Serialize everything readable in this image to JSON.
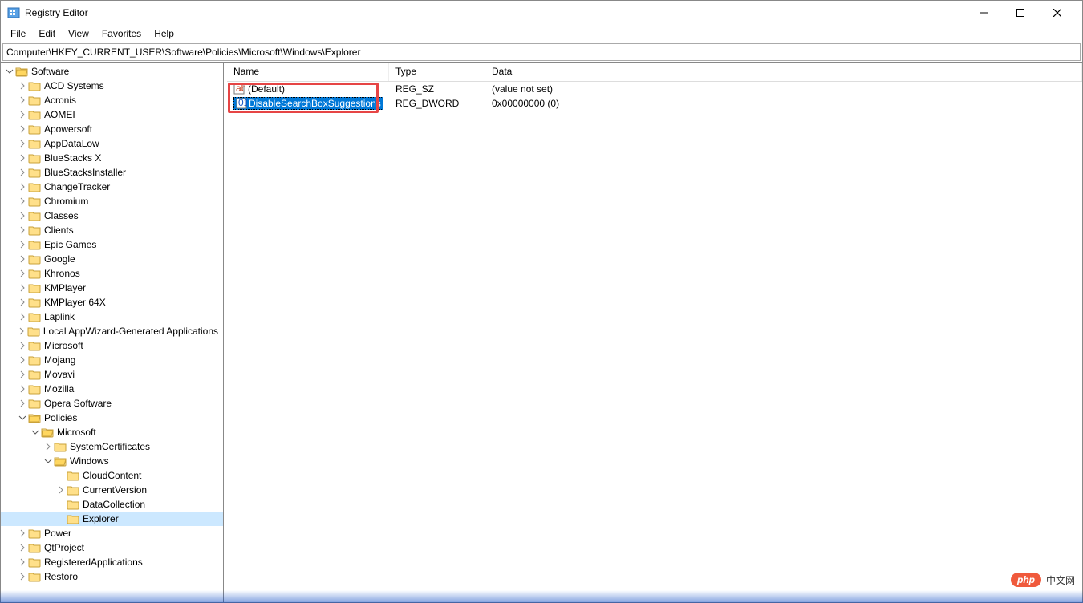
{
  "window": {
    "title": "Registry Editor"
  },
  "menubar": [
    "File",
    "Edit",
    "View",
    "Favorites",
    "Help"
  ],
  "address": "Computer\\HKEY_CURRENT_USER\\Software\\Policies\\Microsoft\\Windows\\Explorer",
  "columns": {
    "name": "Name",
    "type": "Type",
    "data": "Data"
  },
  "values": [
    {
      "icon": "sz",
      "name": "(Default)",
      "type": "REG_SZ",
      "data": "(value not set)",
      "editing": false
    },
    {
      "icon": "dw",
      "name": "DisableSearchBoxSuggestions",
      "type": "REG_DWORD",
      "data": "0x00000000 (0)",
      "editing": true
    }
  ],
  "tree": [
    {
      "depth": 0,
      "toggle": "open",
      "label": "Software",
      "open": true
    },
    {
      "depth": 1,
      "toggle": "closed",
      "label": "ACD Systems"
    },
    {
      "depth": 1,
      "toggle": "closed",
      "label": "Acronis"
    },
    {
      "depth": 1,
      "toggle": "closed",
      "label": "AOMEI"
    },
    {
      "depth": 1,
      "toggle": "closed",
      "label": "Apowersoft"
    },
    {
      "depth": 1,
      "toggle": "closed",
      "label": "AppDataLow"
    },
    {
      "depth": 1,
      "toggle": "closed",
      "label": "BlueStacks X"
    },
    {
      "depth": 1,
      "toggle": "closed",
      "label": "BlueStacksInstaller"
    },
    {
      "depth": 1,
      "toggle": "closed",
      "label": "ChangeTracker"
    },
    {
      "depth": 1,
      "toggle": "closed",
      "label": "Chromium"
    },
    {
      "depth": 1,
      "toggle": "closed",
      "label": "Classes"
    },
    {
      "depth": 1,
      "toggle": "closed",
      "label": "Clients"
    },
    {
      "depth": 1,
      "toggle": "closed",
      "label": "Epic Games"
    },
    {
      "depth": 1,
      "toggle": "closed",
      "label": "Google"
    },
    {
      "depth": 1,
      "toggle": "closed",
      "label": "Khronos"
    },
    {
      "depth": 1,
      "toggle": "closed",
      "label": "KMPlayer"
    },
    {
      "depth": 1,
      "toggle": "closed",
      "label": "KMPlayer 64X"
    },
    {
      "depth": 1,
      "toggle": "closed",
      "label": "Laplink"
    },
    {
      "depth": 1,
      "toggle": "closed",
      "label": "Local AppWizard-Generated Applications"
    },
    {
      "depth": 1,
      "toggle": "closed",
      "label": "Microsoft"
    },
    {
      "depth": 1,
      "toggle": "closed",
      "label": "Mojang"
    },
    {
      "depth": 1,
      "toggle": "closed",
      "label": "Movavi"
    },
    {
      "depth": 1,
      "toggle": "closed",
      "label": "Mozilla"
    },
    {
      "depth": 1,
      "toggle": "closed",
      "label": "Opera Software"
    },
    {
      "depth": 1,
      "toggle": "open",
      "label": "Policies",
      "open": true
    },
    {
      "depth": 2,
      "toggle": "open",
      "label": "Microsoft",
      "open": true
    },
    {
      "depth": 3,
      "toggle": "closed",
      "label": "SystemCertificates"
    },
    {
      "depth": 3,
      "toggle": "open",
      "label": "Windows",
      "open": true
    },
    {
      "depth": 4,
      "toggle": "none",
      "label": "CloudContent"
    },
    {
      "depth": 4,
      "toggle": "closed",
      "label": "CurrentVersion"
    },
    {
      "depth": 4,
      "toggle": "none",
      "label": "DataCollection"
    },
    {
      "depth": 4,
      "toggle": "none",
      "label": "Explorer",
      "selected": true
    },
    {
      "depth": 1,
      "toggle": "closed",
      "label": "Power"
    },
    {
      "depth": 1,
      "toggle": "closed",
      "label": "QtProject"
    },
    {
      "depth": 1,
      "toggle": "closed",
      "label": "RegisteredApplications"
    },
    {
      "depth": 1,
      "toggle": "closed",
      "label": "Restoro"
    }
  ],
  "watermark": {
    "badge": "php",
    "text": "中文网"
  }
}
